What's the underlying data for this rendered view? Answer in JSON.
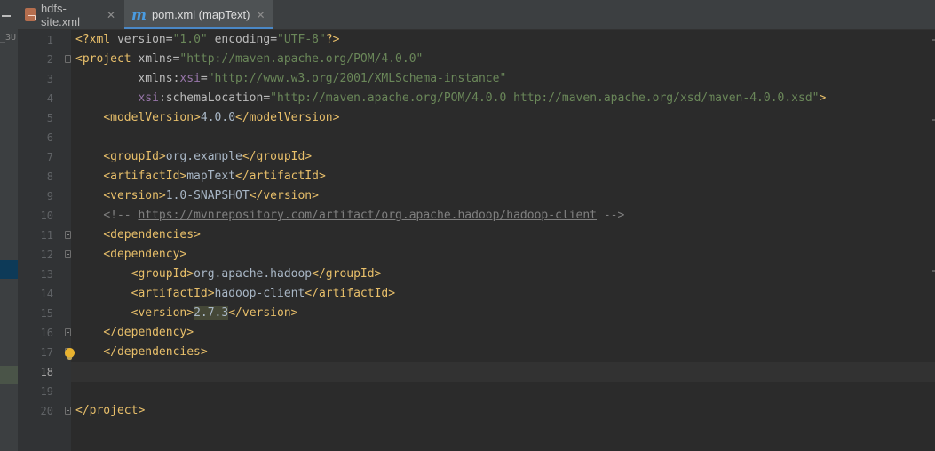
{
  "sidebar": {
    "fragment": "_3U"
  },
  "tabs": [
    {
      "label": "hdfs-site.xml",
      "icon": "xml-file-icon",
      "active": false
    },
    {
      "label": "pom.xml (mapText)",
      "icon": "maven-icon",
      "active": true
    }
  ],
  "editor": {
    "current_line": 18,
    "line_numbers": [
      "1",
      "2",
      "3",
      "4",
      "5",
      "6",
      "7",
      "8",
      "9",
      "10",
      "11",
      "12",
      "13",
      "14",
      "15",
      "16",
      "17",
      "18",
      "19",
      "20"
    ],
    "code": {
      "l1_open": "<?xml",
      "l1_a1": "version",
      "l1_eq1": "=",
      "l1_v1": "\"1.0\"",
      "l1_a2": "encoding",
      "l1_eq2": "=",
      "l1_v2": "\"UTF-8\"",
      "l1_close": "?>",
      "l2_tag": "<project",
      "l2_a": "xmlns",
      "l2_eq": "=",
      "l2_v": "\"http://maven.apache.org/POM/4.0.0\"",
      "l3_a": "xmlns",
      "l3_colon": ":",
      "l3_ns": "xsi",
      "l3_eq": "=",
      "l3_v": "\"http://www.w3.org/2001/XMLSchema-instance\"",
      "l4_ns": "xsi",
      "l4_a": ":schemaLocation",
      "l4_eq": "=",
      "l4_v": "\"http://maven.apache.org/POM/4.0.0 http://maven.apache.org/xsd/maven-4.0.0.xsd\"",
      "l4_close": ">",
      "l5_open": "<modelVersion>",
      "l5_text": "4.0.0",
      "l5_close": "</modelVersion>",
      "l7_open": "<groupId>",
      "l7_text": "org.example",
      "l7_close": "</groupId>",
      "l8_open": "<artifactId>",
      "l8_text": "mapText",
      "l8_close": "</artifactId>",
      "l9_open": "<version>",
      "l9_text": "1.0-SNAPSHOT",
      "l9_close": "</version>",
      "l10_open": "<!--",
      "l10_url": "https://mvnrepository.com/artifact/org.apache.hadoop/hadoop-client",
      "l10_close": "-->",
      "l11": "<dependencies>",
      "l12": "<dependency>",
      "l13_open": "<groupId>",
      "l13_text": "org.apache.hadoop",
      "l13_close": "</groupId>",
      "l14_open": "<artifactId>",
      "l14_text": "hadoop-client",
      "l14_close": "</artifactId>",
      "l15_open": "<version>",
      "l15_text": "2.7.3",
      "l15_close": "</version>",
      "l16": "</dependency>",
      "l17": "</dependencies>",
      "l20": "</project>"
    }
  },
  "colors": {
    "background": "#2b2b2b",
    "tag": "#e8bf6a",
    "attribute_value": "#6a8759",
    "namespace": "#9876aa",
    "comment": "#808080",
    "accent": "#4a88c7"
  }
}
